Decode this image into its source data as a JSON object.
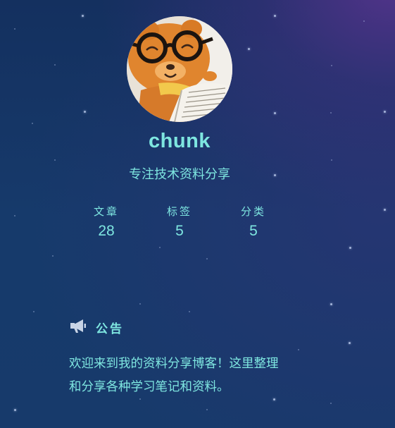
{
  "author": {
    "name": "chunk",
    "description": "专注技术资料分享"
  },
  "stats": [
    {
      "label": "文章",
      "value": "28"
    },
    {
      "label": "标签",
      "value": "5"
    },
    {
      "label": "分类",
      "value": "5"
    }
  ],
  "announcement": {
    "icon": "megaphone-icon",
    "title": "公告",
    "content": "欢迎来到我的资料分享博客！这里整理和分享各种学习笔记和资料。"
  },
  "colors": {
    "accent": "#7ee6e0",
    "background_top": "#14305f",
    "background_glow": "#55348c"
  }
}
